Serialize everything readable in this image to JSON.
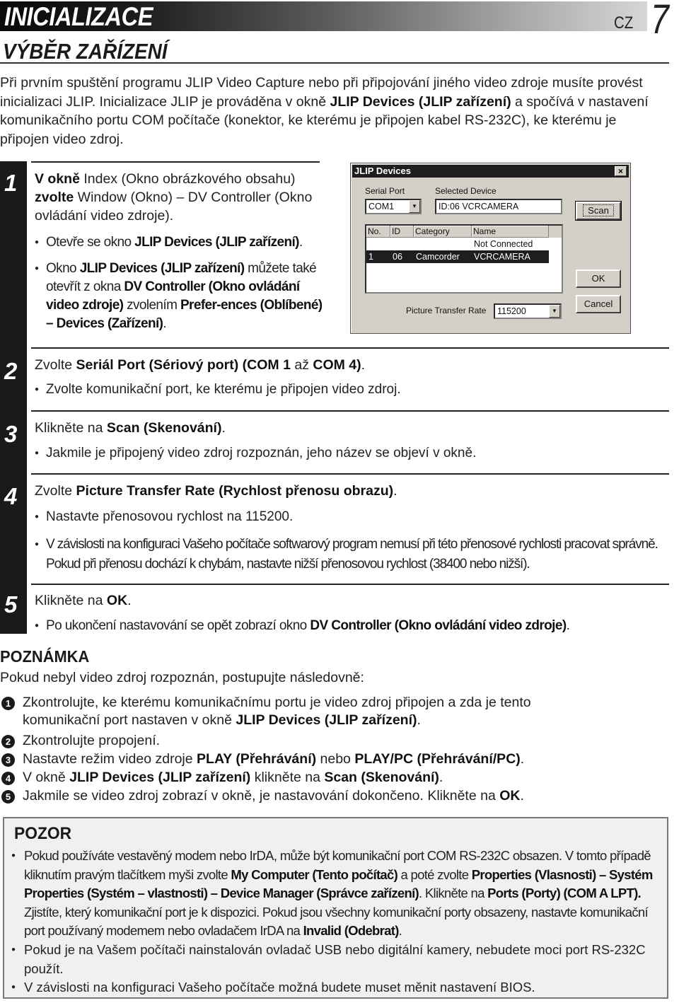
{
  "header": {
    "banner_title": "INICIALIZACE",
    "language": "CZ",
    "page_number": "7",
    "section_title": "VÝBĚR ZAŘÍZENÍ"
  },
  "intro": {
    "p1": "Při prvním spuštění programu JLIP Video Capture nebo při připojování jiného  video zdroje musíte provést inicializaci JLIP. Inicializace JLIP je prováděna v okně ",
    "b1": "JLIP Devices (JLIP zařízení)",
    "p2": " a spočívá v nastavení komunikačního portu COM počítače (konektor, ke kterému je připojen kabel RS-232C), ke kterému je připojen video zdroj."
  },
  "steps": [
    {
      "number": "1",
      "parts": [
        {
          "b": "V okně"
        },
        {
          "t": " Index (Okno obrázkového obsahu) "
        },
        {
          "b": "zvolte"
        },
        {
          "t": " Window (Okno) – DV Controller (Okno ovládání video zdroje)."
        }
      ],
      "bullets": [
        [
          {
            "t": "Otevře se okno "
          },
          {
            "b": "JLIP Devices (JLIP zařízení)"
          },
          {
            "t": "."
          }
        ],
        [
          {
            "t": "Okno "
          },
          {
            "b": "JLIP Devices (JLIP zařízení)"
          },
          {
            "t": " můžete také otevřít z okna "
          },
          {
            "b": "DV Controller (Okno ovládání video zdroje)"
          },
          {
            "t": " zvolením "
          },
          {
            "b": "Prefer-ences (Oblíbené) – Devices (Zařízení)"
          },
          {
            "t": "."
          }
        ]
      ]
    },
    {
      "number": "2",
      "parts": [
        {
          "t": "Zvolte "
        },
        {
          "b": "Seriál Port (Sériový port) (COM 1"
        },
        {
          "t": " až "
        },
        {
          "b": "COM 4)"
        },
        {
          "t": "."
        }
      ],
      "bullets": [
        [
          {
            "t": "Zvolte komunikační port, ke kterému je připojen video zdroj."
          }
        ]
      ]
    },
    {
      "number": "3",
      "parts": [
        {
          "t": "Klikněte na "
        },
        {
          "b": "Scan (Skenování)"
        },
        {
          "t": "."
        }
      ],
      "bullets": [
        [
          {
            "t": "Jakmile je připojený video zdroj rozpoznán, jeho název se objeví v okně."
          }
        ]
      ]
    },
    {
      "number": "4",
      "parts": [
        {
          "t": "Zvolte "
        },
        {
          "b": "Picture Transfer Rate (Rychlost přenosu obrazu)"
        },
        {
          "t": "."
        }
      ],
      "bullets": [
        [
          {
            "t": "Nastavte přenosovou rychlost na 115200."
          }
        ],
        [
          {
            "t": "V závislosti na konfiguraci Vašeho počítače softwarový program nemusí při této přenosové rychlosti pracovat správně. Pokud při přenosu dochází k chybám, nastavte nižší přenosovou rychlost (38400 nebo nižší)."
          }
        ]
      ]
    },
    {
      "number": "5",
      "parts": [
        {
          "t": "Klikněte na "
        },
        {
          "b": "OK"
        },
        {
          "t": "."
        }
      ],
      "bullets": [
        [
          {
            "t": "Po ukončení nastavování se opět zobrazí okno "
          },
          {
            "b": "DV Controller (Okno ovládání video zdroje)"
          },
          {
            "t": "."
          }
        ]
      ]
    }
  ],
  "dialog": {
    "title": "JLIP Devices",
    "close_icon": "×",
    "serial_port_label": "Serial Port",
    "serial_port_value": "COM1",
    "selected_device_label": "Selected Device",
    "selected_device_value": "ID:06 VCRCAMERA",
    "scan_button": "Scan",
    "ok_button": "OK",
    "cancel_button": "Cancel",
    "columns": [
      "No.",
      "ID",
      "Category",
      "Name"
    ],
    "rows": [
      {
        "no": "",
        "id": "",
        "category": "",
        "name": "Not Connected",
        "selected": false
      },
      {
        "no": "1",
        "id": "06",
        "category": "Camcorder",
        "name": "VCRCAMERA",
        "selected": true
      }
    ],
    "transfer_rate_label": "Picture Transfer Rate",
    "transfer_rate_value": "115200",
    "dropdown_arrow": "▼"
  },
  "note": {
    "title": "POZNÁMKA",
    "intro": "Pokud nebyl video zdroj rozpoznán, postupujte následovně:",
    "items": [
      {
        "n": "1",
        "parts": [
          {
            "t": "Zkontrolujte, ke kterému komunikačnímu portu je video zdroj připojen a zda je tento komunikační port nastaven v okně "
          },
          {
            "b": "JLIP Devices (JLIP zařízení)"
          },
          {
            "t": "."
          }
        ]
      },
      {
        "n": "2",
        "parts": [
          {
            "t": "Zkontrolujte propojení."
          }
        ]
      },
      {
        "n": "3",
        "parts": [
          {
            "t": "Nastavte režim video zdroje "
          },
          {
            "b": "PLAY (Přehrávání)"
          },
          {
            "t": " nebo "
          },
          {
            "b": "PLAY/PC (Přehrávání/PC)"
          },
          {
            "t": "."
          }
        ]
      },
      {
        "n": "4",
        "parts": [
          {
            "t": "V okně "
          },
          {
            "b": "JLIP Devices (JLIP zařízení)"
          },
          {
            "t": " klikněte na "
          },
          {
            "b": "Scan (Skenování)"
          },
          {
            "t": "."
          }
        ]
      },
      {
        "n": "5",
        "parts": [
          {
            "t": "Jakmile se video zdroj zobrazí v okně, je nastavování dokončeno. Klikněte na "
          },
          {
            "b": "OK"
          },
          {
            "t": "."
          }
        ]
      }
    ]
  },
  "caution": {
    "title": "POZOR",
    "items": [
      [
        {
          "t": "Pokud používáte vestavěný modem nebo IrDA, může být komunikační port COM RS-232C obsazen. V tomto případě kliknutím pravým tlačítkem myši zvolte "
        },
        {
          "b": "My Computer (Tento počítač)"
        },
        {
          "t": " a poté zvolte "
        },
        {
          "b": "Properties (Vlasnosti) – Systém Properties (Systém – vlastnosti) – Device Manager (Správce zařízení)"
        },
        {
          "t": ". Klikněte na "
        },
        {
          "b": "Ports (Porty) (COM A LPT)."
        },
        {
          "t": " Zjistíte, který komunikační port je k dispozici. Pokud jsou všechny komunikační porty obsazeny, nastavte komunikační port používaný modemem nebo ovladačem IrDA na "
        },
        {
          "b": "Invalid (Odebrat)"
        },
        {
          "t": "."
        }
      ],
      [
        {
          "t": "Pokud je na Vašem počítači nainstalován ovladač USB nebo digitální kamery, nebudete moci port RS-232C použít."
        }
      ],
      [
        {
          "t": "V závislosti na konfiguraci Vašeho počítače možná budete muset měnit nastavení BIOS."
        }
      ]
    ]
  }
}
